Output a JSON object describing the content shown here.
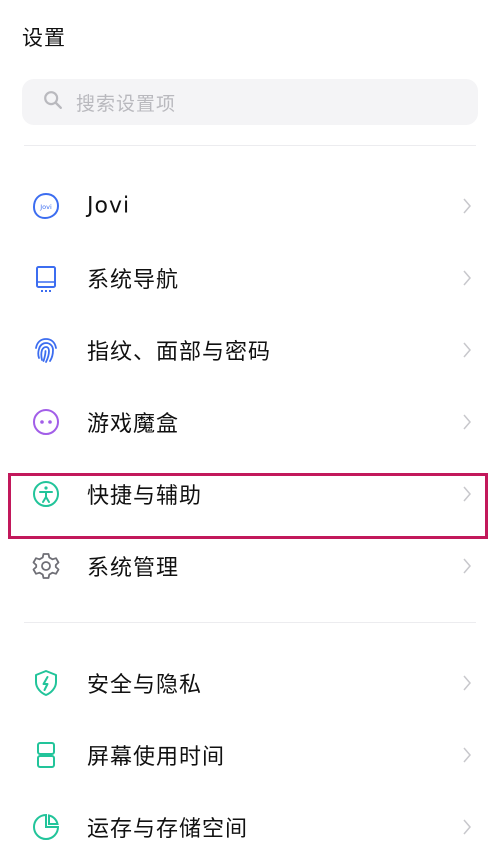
{
  "header": {
    "title": "设置"
  },
  "search": {
    "placeholder": "搜索设置项"
  },
  "section1": {
    "items": [
      {
        "label": "Jovi",
        "icon": "jovi-icon"
      },
      {
        "label": "系统导航",
        "icon": "system-navigation-icon"
      },
      {
        "label": "指纹、面部与密码",
        "icon": "fingerprint-icon"
      },
      {
        "label": "游戏魔盒",
        "icon": "game-box-icon"
      },
      {
        "label": "快捷与辅助",
        "icon": "accessibility-icon"
      },
      {
        "label": "系统管理",
        "icon": "gear-icon"
      }
    ]
  },
  "section2": {
    "items": [
      {
        "label": "安全与隐私",
        "icon": "shield-icon"
      },
      {
        "label": "屏幕使用时间",
        "icon": "hourglass-icon"
      },
      {
        "label": "运存与存储空间",
        "icon": "storage-icon"
      }
    ]
  },
  "colors": {
    "blue": "#3c6df0",
    "purple": "#a25ee8",
    "green": "#22c49a",
    "gray": "#6f6f76",
    "highlight": "#c2185b"
  }
}
